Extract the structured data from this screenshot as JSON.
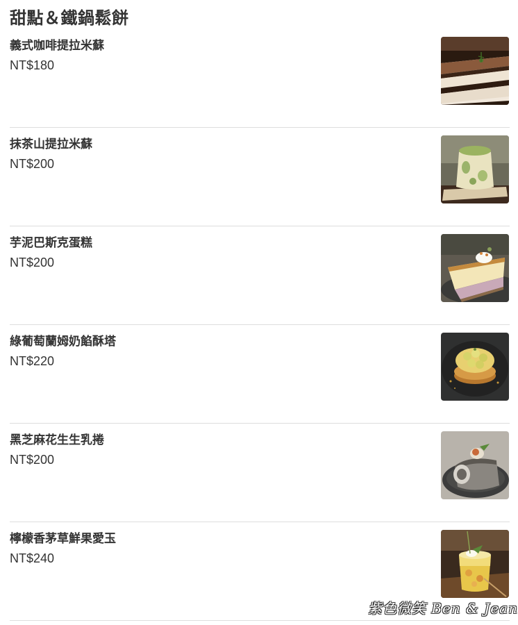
{
  "section": {
    "title": "甜點＆鐵鍋鬆餅"
  },
  "items": [
    {
      "name": "義式咖啡提拉米蘇",
      "price": "NT$180",
      "photo": "tiramisu-photo"
    },
    {
      "name": "抹茶山提拉米蘇",
      "price": "NT$200",
      "photo": "matcha-tiramisu-photo"
    },
    {
      "name": "芋泥巴斯克蛋糕",
      "price": "NT$200",
      "photo": "taro-basque-cake-photo"
    },
    {
      "name": "綠葡萄蘭姆奶餡酥塔",
      "price": "NT$220",
      "photo": "green-grape-tart-photo"
    },
    {
      "name": "黑芝麻花生生乳捲",
      "price": "NT$200",
      "photo": "black-sesame-roll-photo"
    },
    {
      "name": "檸檬香茅草鮮果愛玉",
      "price": "NT$240",
      "photo": "lemongrass-aiyu-jelly-photo"
    }
  ],
  "watermark": "紫色微笑 Ben & Jean",
  "colors": {
    "text": "#333333",
    "divider": "#dddddd",
    "background": "#ffffff"
  }
}
